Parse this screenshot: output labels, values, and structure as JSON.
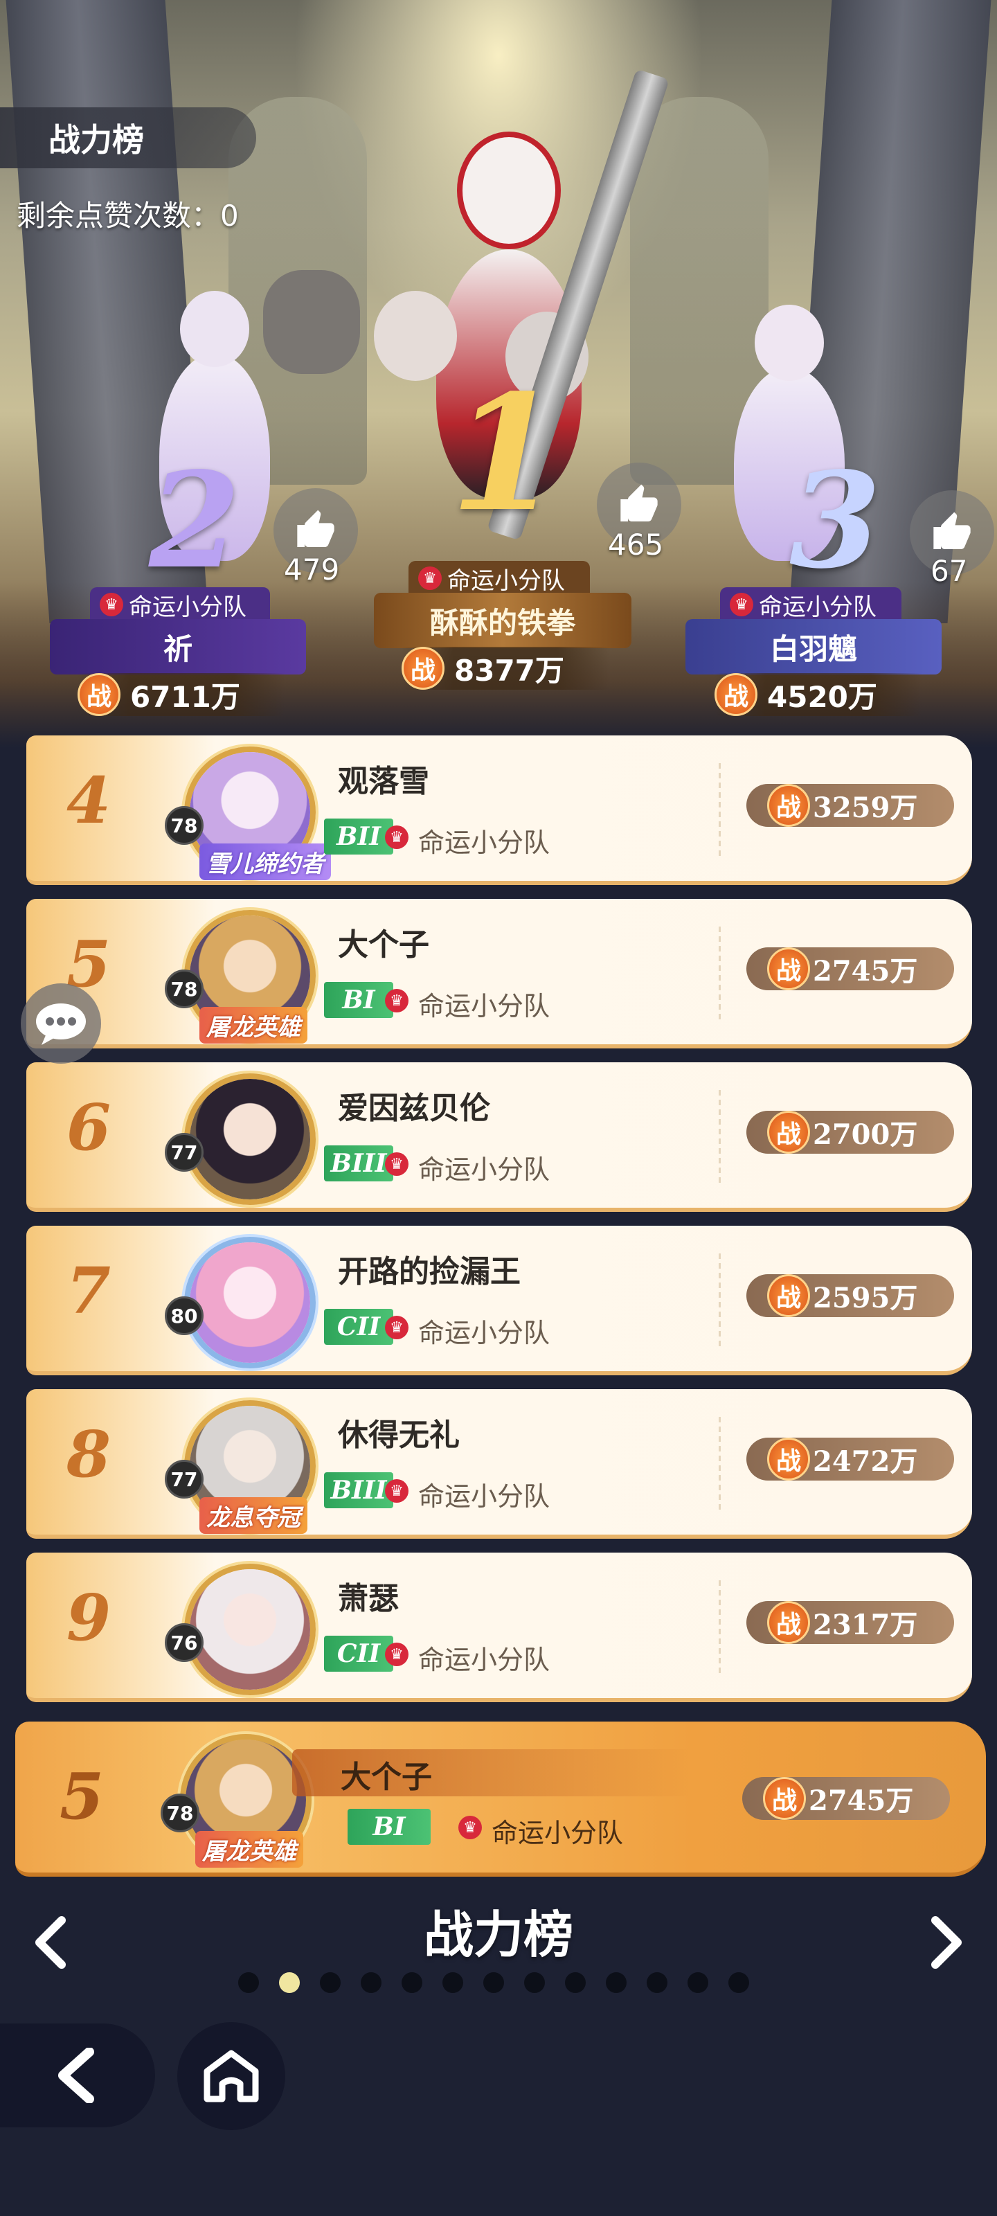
{
  "header": {
    "title": "战力榜",
    "likes_remaining_label": "剩余点赞次数：0"
  },
  "podium": [
    {
      "rank": "2",
      "likes": "479",
      "guild": "命运小分队",
      "name": "祈",
      "power": "6711万"
    },
    {
      "rank": "1",
      "likes": "465",
      "guild": "命运小分队",
      "name": "酥酥的铁拳",
      "power": "8377万"
    },
    {
      "rank": "3",
      "likes": "67",
      "guild": "命运小分队",
      "name": "白羽魑",
      "power": "4520万"
    }
  ],
  "power_glyph": "战",
  "list": [
    {
      "rank": "4",
      "level": "78",
      "name": "观落雪",
      "tier": "BII",
      "guild": "命运小分队",
      "power": "3259万",
      "title_badge": "雪儿缔约者"
    },
    {
      "rank": "5",
      "level": "78",
      "name": "大个子",
      "tier": "BI",
      "guild": "命运小分队",
      "power": "2745万",
      "title_badge": "屠龙英雄"
    },
    {
      "rank": "6",
      "level": "77",
      "name": "爱因兹贝伦",
      "tier": "BIII",
      "guild": "命运小分队",
      "power": "2700万",
      "title_badge": ""
    },
    {
      "rank": "7",
      "level": "80",
      "name": "开路的捡漏王",
      "tier": "CII",
      "guild": "命运小分队",
      "power": "2595万",
      "title_badge": ""
    },
    {
      "rank": "8",
      "level": "77",
      "name": "休得无礼",
      "tier": "BIII",
      "guild": "命运小分队",
      "power": "2472万",
      "title_badge": "龙息夺冠"
    },
    {
      "rank": "9",
      "level": "76",
      "name": "萧瑟",
      "tier": "CII",
      "guild": "命运小分队",
      "power": "2317万",
      "title_badge": ""
    }
  ],
  "my_entry": {
    "rank": "5",
    "level": "78",
    "name": "大个子",
    "tier": "BI",
    "guild": "命运小分队",
    "power": "2745万",
    "title_badge": "屠龙英雄"
  },
  "pager": {
    "title": "战力榜",
    "page_count": 13,
    "active_index": 1
  },
  "icons": {
    "like": "thumbs-up-icon",
    "crown": "crown-icon",
    "chat": "chat-bubble-icon",
    "back": "back-arrow-icon",
    "home": "home-icon",
    "prev": "chevron-left-icon",
    "next": "chevron-right-icon"
  },
  "colors": {
    "accent_orange": "#d9541a",
    "tier_green": "#2ea45a",
    "guild_crown_red": "#d8283b",
    "page_bg": "#1d2133"
  }
}
